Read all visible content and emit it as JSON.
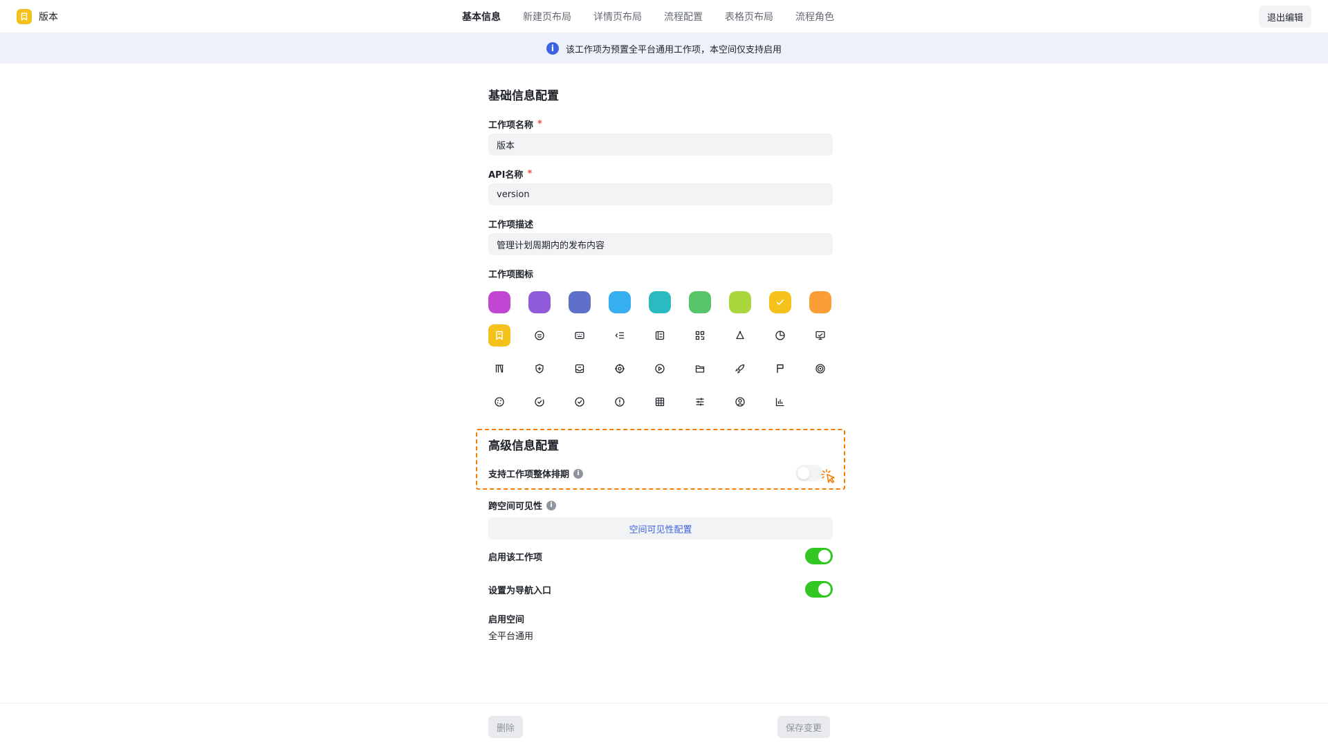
{
  "app": {
    "name": "版本",
    "icon": "bookmark-icon",
    "icon_color": "#f4c21a"
  },
  "tabs": [
    {
      "label": "基本信息",
      "active": true
    },
    {
      "label": "新建页布局",
      "active": false
    },
    {
      "label": "详情页布局",
      "active": false
    },
    {
      "label": "流程配置",
      "active": false
    },
    {
      "label": "表格页布局",
      "active": false
    },
    {
      "label": "流程角色",
      "active": false
    }
  ],
  "exit_label": "退出编辑",
  "notice": {
    "text": "该工作项为预置全平台通用工作项，本空间仅支持启用",
    "icon": "info-icon"
  },
  "basic": {
    "title": "基础信息配置",
    "name_label": "工作项名称",
    "name_value": "版本",
    "api_label": "API名称",
    "api_value": "version",
    "desc_label": "工作项描述",
    "desc_value": "管理计划周期内的发布内容",
    "icon_label": "工作项图标",
    "required_mark": "*"
  },
  "colors": [
    "#c146d1",
    "#8f5bdb",
    "#5f70c8",
    "#36aef0",
    "#2bbac2",
    "#57c46a",
    "#a8d63c",
    "#f4c21a",
    "#fb9e35"
  ],
  "selected_color": "#f4c21a",
  "icons": [
    "bookmark-icon",
    "smiley-icon",
    "keyboard-icon",
    "indent-list-icon",
    "list-icon",
    "qr-code-icon",
    "triangle-nodes-icon",
    "pie-chart-icon",
    "presentation-icon",
    "book-icon",
    "shield-plus-icon",
    "inbox-icon",
    "target-crosshair-icon",
    "play-circle-icon",
    "folder-icon",
    "rocket-icon",
    "flag-icon",
    "bullseye-icon",
    "palette-icon",
    "check-badge-icon",
    "check-circle-icon",
    "alert-circle-icon",
    "grid-table-icon",
    "sliders-icon",
    "user-circle-icon",
    "bar-chart-icon"
  ],
  "advanced": {
    "title": "高级信息配置",
    "schedule_label": "支持工作项整体排期",
    "schedule_on": false,
    "cross_label": "跨空间可见性",
    "visibility_button": "空间可见性配置",
    "enable_label": "启用该工作项",
    "enable_on": true,
    "nav_label": "设置为导航入口",
    "nav_on": true,
    "space_label": "启用空间",
    "space_value": "全平台通用"
  },
  "footer": {
    "delete_label": "删除",
    "save_label": "保存变更"
  }
}
